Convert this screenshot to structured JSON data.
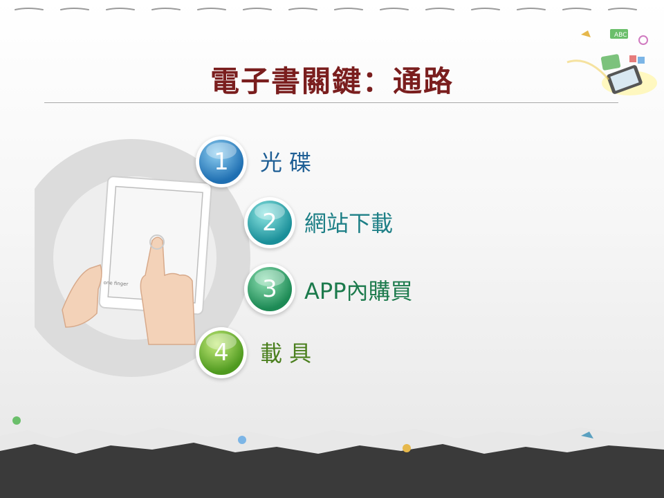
{
  "slide": {
    "title": "電子書關鍵：通路",
    "items": [
      {
        "number": "1",
        "label": "光 碟",
        "color": "#1f5f95"
      },
      {
        "number": "2",
        "label": "網站下載",
        "color": "#1d7f86"
      },
      {
        "number": "3",
        "label": "APP內購買",
        "color": "#1c7a4c"
      },
      {
        "number": "4",
        "label": "載 具",
        "color": "#4a7f1d"
      }
    ],
    "device_caption": "one finger"
  },
  "colors": {
    "title": "#7a1e1e",
    "badge1": "#1f6fb2",
    "badge2": "#1a8f99",
    "badge3": "#1d8a55",
    "badge4": "#4f9a1f"
  }
}
